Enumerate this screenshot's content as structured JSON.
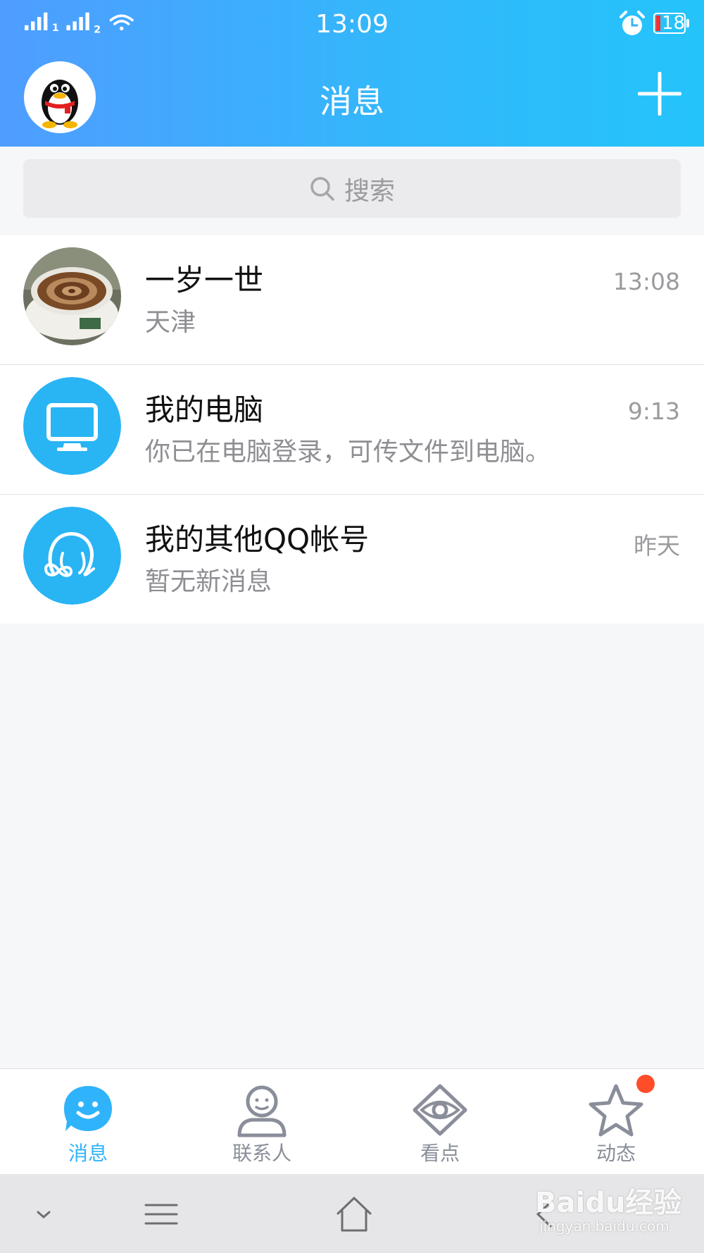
{
  "status_bar": {
    "time": "13:09",
    "battery": "18",
    "sim1": "1",
    "sim2": "2",
    "icons": [
      "signal-icon",
      "wifi-icon",
      "alarm-icon",
      "battery-icon"
    ]
  },
  "header": {
    "title": "消息",
    "avatar_icon": "qq-penguin-icon",
    "add_icon": "plus-icon"
  },
  "search": {
    "placeholder": "搜索",
    "icon": "search-icon"
  },
  "conversations": [
    {
      "name": "一岁一世",
      "message": "天津",
      "time": "13:08",
      "avatar": "coffee-photo"
    },
    {
      "name": "我的电脑",
      "message": "你已在电脑登录，可传文件到电脑。",
      "time": "9:13",
      "avatar": "monitor-icon"
    },
    {
      "name": "我的其他QQ帐号",
      "message": "暂无新消息",
      "time": "昨天",
      "avatar": "accounts-icon"
    }
  ],
  "tabs": [
    {
      "label": "消息",
      "icon": "smile-bubble-icon",
      "active": true
    },
    {
      "label": "联系人",
      "icon": "person-icon",
      "active": false
    },
    {
      "label": "看点",
      "icon": "eye-icon",
      "active": false
    },
    {
      "label": "动态",
      "icon": "star-icon",
      "active": false,
      "badge": true
    }
  ],
  "nav_bar": {
    "icons": [
      "chevron-down-icon",
      "menu-icon",
      "home-icon",
      "back-icon"
    ]
  },
  "watermark": {
    "main": "Baidu经验",
    "sub": "jingyan.baidu.com"
  },
  "colors": {
    "header_start": "#4f9dff",
    "header_end": "#24c4fb",
    "accent": "#2fb3fa",
    "badge": "#ff4d2a",
    "icon_avatar_bg": "#29b4f4"
  }
}
